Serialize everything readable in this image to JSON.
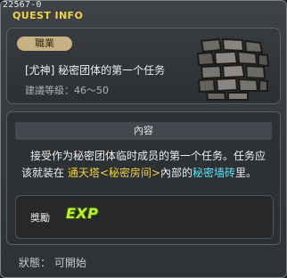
{
  "window": {
    "quest_id": "22567-0",
    "title": "QUEST INFO"
  },
  "quest": {
    "category": "職業",
    "name": "[尤神]  秘密团体的第一个任务",
    "required_level": "建議等級：46～50",
    "icon": "stone-brick-wall-icon"
  },
  "content": {
    "header": "內容",
    "description_parts": {
      "p1": "接受作为秘密团体临时成员的第一个任务。任务应",
      "p2": "该就装在 ",
      "location": "通天塔<秘密房间>",
      "p3": "內部的",
      "target": "秘密墙砖",
      "p4": "里。"
    }
  },
  "reward": {
    "label": "獎勵",
    "exp": "EXP"
  },
  "status": "狀態： 可開始",
  "colors": {
    "title": "#f1d340",
    "location_highlight": "#f0d13f",
    "target_highlight": "#5fe3f5",
    "exp": "#b9ef2e",
    "badge": "#c6b084"
  }
}
